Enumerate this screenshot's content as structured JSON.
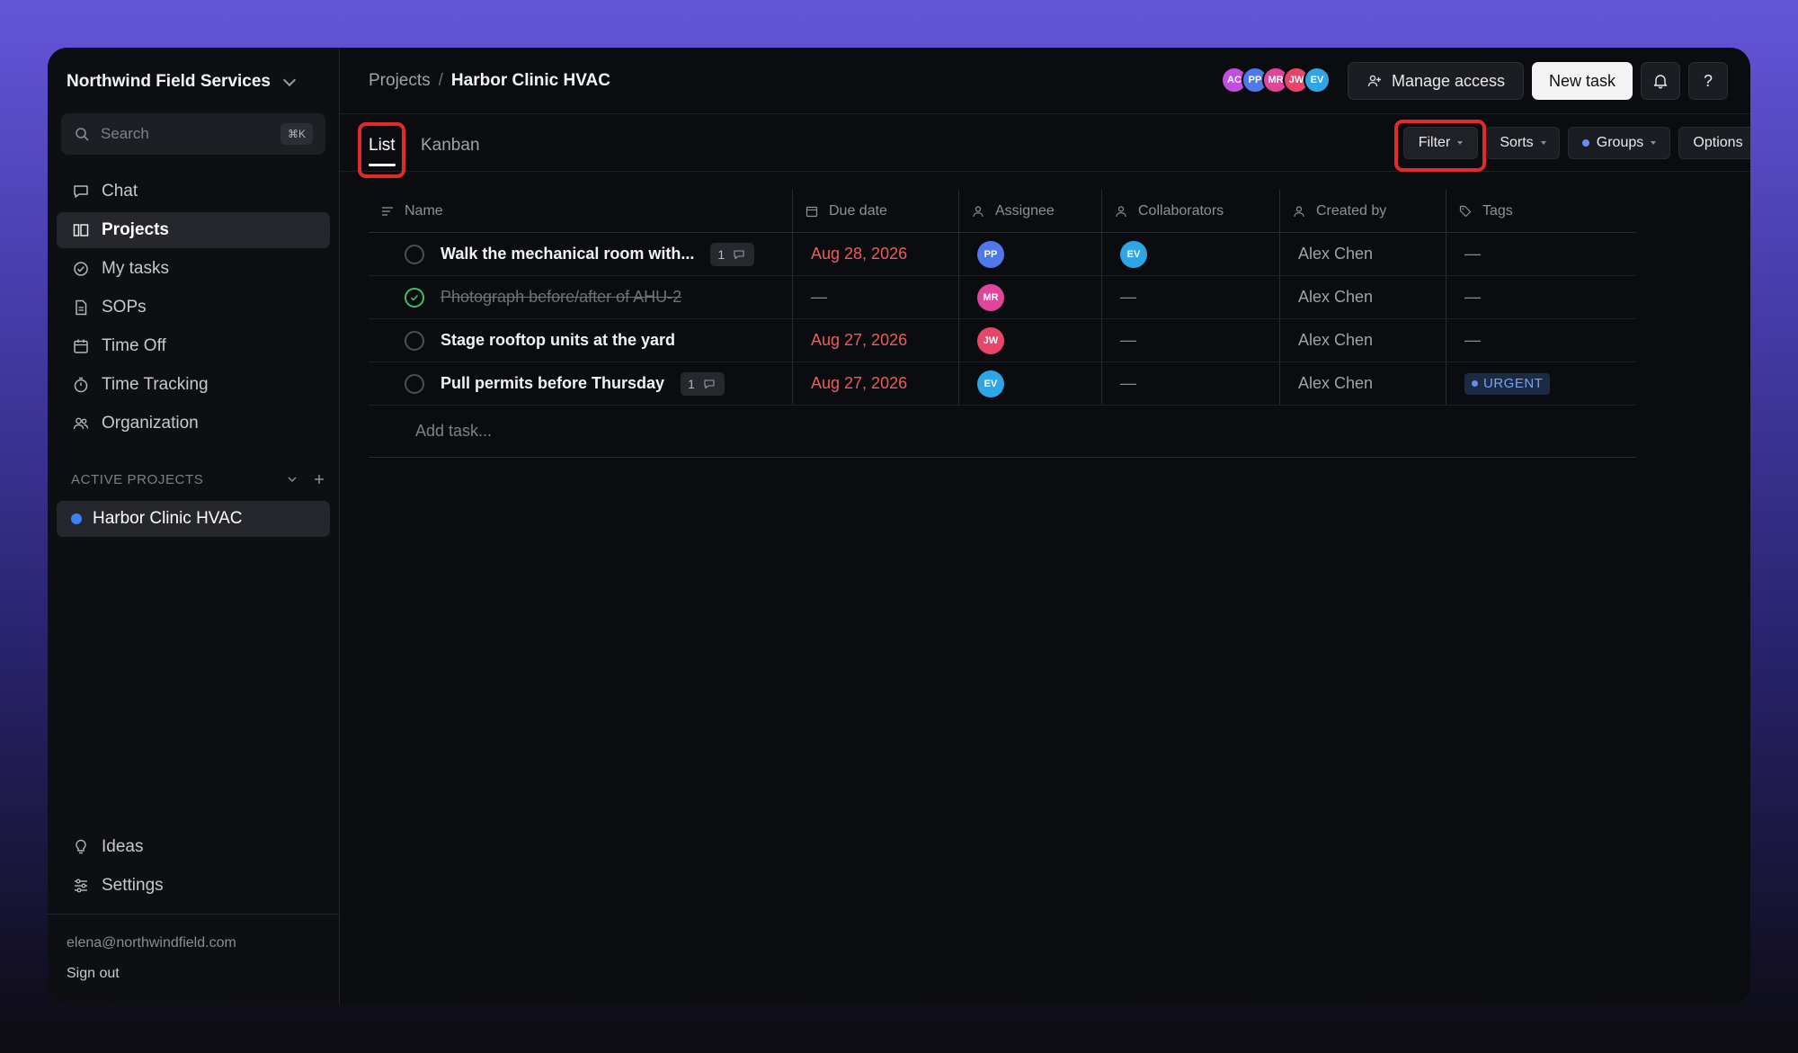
{
  "sidebar": {
    "org_name": "Northwind Field Services",
    "search": {
      "placeholder": "Search",
      "shortcut": "⌘K"
    },
    "nav": [
      {
        "label": "Chat",
        "icon": "chat-icon"
      },
      {
        "label": "Projects",
        "icon": "projects-icon",
        "active": true
      },
      {
        "label": "My tasks",
        "icon": "check-circle-icon"
      },
      {
        "label": "SOPs",
        "icon": "document-icon"
      },
      {
        "label": "Time Off",
        "icon": "calendar-icon"
      },
      {
        "label": "Time Tracking",
        "icon": "timer-icon"
      },
      {
        "label": "Organization",
        "icon": "people-icon"
      }
    ],
    "active_projects": {
      "heading": "ACTIVE PROJECTS",
      "items": [
        {
          "label": "Harbor Clinic HVAC",
          "color": "#3b82f6"
        }
      ]
    },
    "bottom_nav": [
      {
        "label": "Ideas",
        "icon": "lightbulb-icon"
      },
      {
        "label": "Settings",
        "icon": "sliders-icon"
      }
    ],
    "user_email": "elena@northwindfield.com",
    "sign_out": "Sign out"
  },
  "header": {
    "breadcrumb": {
      "parent": "Projects",
      "separator": "/",
      "current": "Harbor Clinic HVAC"
    },
    "members": [
      {
        "initials": "AC",
        "color": "#c04fe0"
      },
      {
        "initials": "PP",
        "color": "#4f78e8"
      },
      {
        "initials": "MR",
        "color": "#e0459a"
      },
      {
        "initials": "JW",
        "color": "#e8456a"
      },
      {
        "initials": "EV",
        "color": "#2ea6e6"
      }
    ],
    "manage_access": "Manage access",
    "new_task": "New task",
    "help": "?"
  },
  "views": {
    "tabs": [
      {
        "label": "List",
        "active": true
      },
      {
        "label": "Kanban"
      }
    ],
    "filter": "Filter",
    "sorts": "Sorts",
    "groups": "Groups",
    "options": "Options"
  },
  "table": {
    "columns": {
      "name": "Name",
      "due": "Due date",
      "assignee": "Assignee",
      "collaborators": "Collaborators",
      "created_by": "Created by",
      "tags": "Tags"
    },
    "rows": [
      {
        "name": "Walk the mechanical room with...",
        "done": false,
        "comments": "1",
        "due": "Aug 28, 2026",
        "assignee": {
          "initials": "PP",
          "color": "#4f78e8"
        },
        "collaborator": {
          "initials": "EV",
          "color": "#2ea6e6"
        },
        "created_by": "Alex Chen",
        "tag": "—"
      },
      {
        "name": "Photograph before/after of AHU-2",
        "done": true,
        "comments": "",
        "due": "—",
        "assignee": {
          "initials": "MR",
          "color": "#e0459a"
        },
        "collaborator": null,
        "created_by": "Alex Chen",
        "tag": "—"
      },
      {
        "name": "Stage rooftop units at the yard",
        "done": false,
        "comments": "",
        "due": "Aug 27, 2026",
        "assignee": {
          "initials": "JW",
          "color": "#e8456a"
        },
        "collaborator": null,
        "created_by": "Alex Chen",
        "tag": "—"
      },
      {
        "name": "Pull permits before Thursday",
        "done": false,
        "comments": "1",
        "due": "Aug 27, 2026",
        "assignee": {
          "initials": "EV",
          "color": "#2ea6e6"
        },
        "collaborator": null,
        "created_by": "Alex Chen",
        "tag": "URGENT"
      }
    ],
    "empty_value": "—",
    "add_task": "Add task..."
  }
}
